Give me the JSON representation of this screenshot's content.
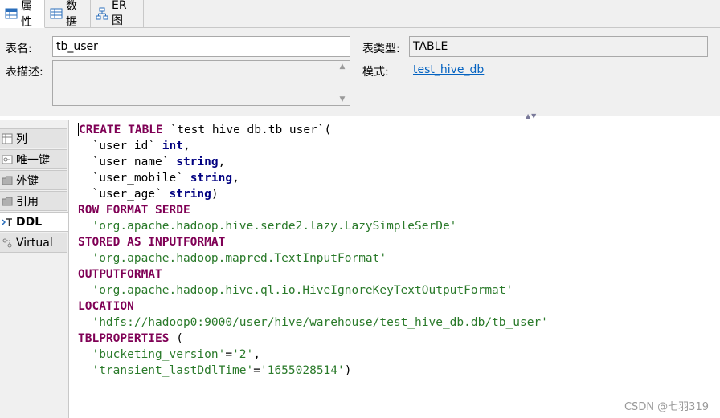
{
  "tabs": [
    {
      "label": "属性",
      "icon": "properties-icon",
      "active": true
    },
    {
      "label": "数据",
      "icon": "data-grid-icon",
      "active": false
    },
    {
      "label": "ER 图",
      "icon": "er-diagram-icon",
      "active": false
    }
  ],
  "form": {
    "table_name_label": "表名:",
    "table_name_value": "tb_user",
    "table_type_label": "表类型:",
    "table_type_value": "TABLE",
    "description_label": "表描述:",
    "description_value": "",
    "schema_label": "模式:",
    "schema_link": "test_hive_db"
  },
  "side_tabs": [
    {
      "label": "列",
      "icon": "columns-icon",
      "active": false
    },
    {
      "label": "唯一键",
      "icon": "unique-key-icon",
      "active": false
    },
    {
      "label": "外键",
      "icon": "foreign-key-icon",
      "active": false
    },
    {
      "label": "引用",
      "icon": "references-icon",
      "active": false
    },
    {
      "label": "DDL",
      "icon": "ddl-icon",
      "active": true
    },
    {
      "label": "Virtual",
      "icon": "virtual-icon",
      "active": false
    }
  ],
  "ddl_lines": [
    [
      {
        "t": "CREATE TABLE",
        "c": "kw"
      },
      {
        "t": " `test_hive_db.tb_user`(",
        "c": ""
      }
    ],
    [
      {
        "t": "  `user_id` ",
        "c": ""
      },
      {
        "t": "int",
        "c": "kw2"
      },
      {
        "t": ",",
        "c": ""
      }
    ],
    [
      {
        "t": "  `user_name` ",
        "c": ""
      },
      {
        "t": "string",
        "c": "kw2"
      },
      {
        "t": ",",
        "c": ""
      }
    ],
    [
      {
        "t": "  `user_mobile` ",
        "c": ""
      },
      {
        "t": "string",
        "c": "kw2"
      },
      {
        "t": ",",
        "c": ""
      }
    ],
    [
      {
        "t": "  `user_age` ",
        "c": ""
      },
      {
        "t": "string",
        "c": "kw2"
      },
      {
        "t": ")",
        "c": ""
      }
    ],
    [
      {
        "t": "ROW FORMAT SERDE",
        "c": "kw"
      }
    ],
    [
      {
        "t": "  'org.apache.hadoop.hive.serde2.lazy.LazySimpleSerDe'",
        "c": "str"
      }
    ],
    [
      {
        "t": "STORED AS INPUTFORMAT",
        "c": "kw"
      }
    ],
    [
      {
        "t": "  'org.apache.hadoop.mapred.TextInputFormat'",
        "c": "str"
      }
    ],
    [
      {
        "t": "OUTPUTFORMAT",
        "c": "kw"
      }
    ],
    [
      {
        "t": "  'org.apache.hadoop.hive.ql.io.HiveIgnoreKeyTextOutputFormat'",
        "c": "str"
      }
    ],
    [
      {
        "t": "LOCATION",
        "c": "kw"
      }
    ],
    [
      {
        "t": "  'hdfs://hadoop0:9000/user/hive/warehouse/test_hive_db.db/tb_user'",
        "c": "str"
      }
    ],
    [
      {
        "t": "TBLPROPERTIES",
        "c": "kw"
      },
      {
        "t": " (",
        "c": ""
      }
    ],
    [
      {
        "t": "  'bucketing_version'",
        "c": "str"
      },
      {
        "t": "=",
        "c": ""
      },
      {
        "t": "'2'",
        "c": "str"
      },
      {
        "t": ",",
        "c": ""
      }
    ],
    [
      {
        "t": "  'transient_lastDdlTime'",
        "c": "str"
      },
      {
        "t": "=",
        "c": ""
      },
      {
        "t": "'1655028514'",
        "c": "str"
      },
      {
        "t": ")",
        "c": ""
      }
    ]
  ],
  "watermark": "CSDN @七羽319",
  "colors": {
    "keyword": "#7f0055",
    "type": "#000080",
    "string": "#2a7a2a",
    "link": "#0563c1"
  }
}
